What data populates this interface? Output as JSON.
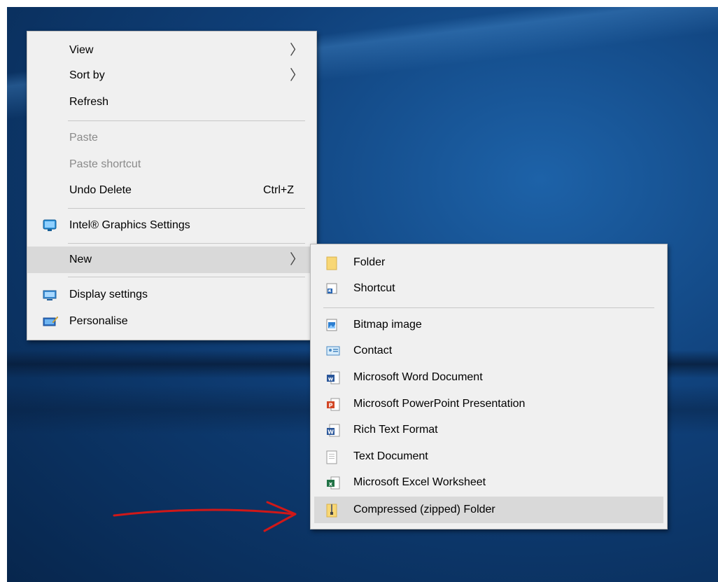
{
  "context_menu": {
    "items": [
      {
        "label": "View",
        "submenu": true
      },
      {
        "label": "Sort by",
        "submenu": true
      },
      {
        "label": "Refresh"
      },
      {
        "label": "Paste",
        "disabled": true
      },
      {
        "label": "Paste shortcut",
        "disabled": true
      },
      {
        "label": "Undo Delete",
        "shortcut": "Ctrl+Z"
      },
      {
        "label": "Intel® Graphics Settings",
        "icon": "intel-graphics-icon"
      },
      {
        "label": "New",
        "submenu": true,
        "highlighted": true
      },
      {
        "label": "Display settings",
        "icon": "display-icon"
      },
      {
        "label": "Personalise",
        "icon": "personalise-icon"
      }
    ],
    "arrow_glyph": "〉"
  },
  "new_submenu": {
    "items": [
      {
        "label": "Folder",
        "icon": "folder-icon"
      },
      {
        "label": "Shortcut",
        "icon": "shortcut-icon"
      },
      {
        "label": "Bitmap image",
        "icon": "bitmap-icon"
      },
      {
        "label": "Contact",
        "icon": "contact-icon"
      },
      {
        "label": "Microsoft Word Document",
        "icon": "word-icon"
      },
      {
        "label": "Microsoft PowerPoint Presentation",
        "icon": "powerpoint-icon"
      },
      {
        "label": "Rich Text Format",
        "icon": "rtf-icon"
      },
      {
        "label": "Text Document",
        "icon": "text-document-icon"
      },
      {
        "label": "Microsoft Excel Worksheet",
        "icon": "excel-icon"
      },
      {
        "label": "Compressed (zipped) Folder",
        "icon": "zip-folder-icon",
        "highlighted": true
      }
    ]
  },
  "colors": {
    "menu_bg": "#f0f0f0",
    "highlight": "#d9d9d9",
    "annotation_arrow": "#d01818"
  }
}
